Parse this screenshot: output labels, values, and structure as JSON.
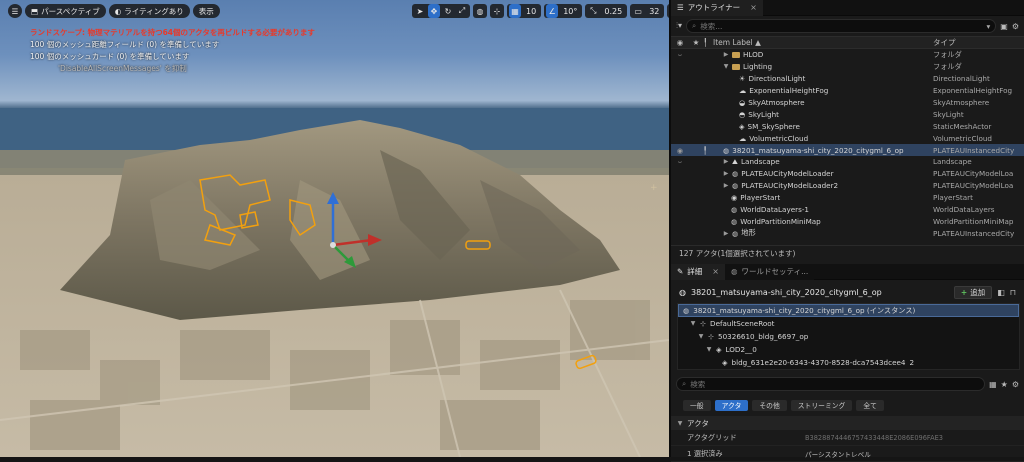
{
  "viewport": {
    "perspective_label": "パースペクティブ",
    "lighting_label": "ライティングあり",
    "show_label": "表示",
    "grid_snap_value": "10",
    "rotation_snap_value": "10°",
    "scale_snap_value": "0.25",
    "camera_speed_value": "32",
    "messages": {
      "warning": "ランドスケープ: 物理マテリアルを持つ64個のアクタを再ビルドする必要があります",
      "info1": "100 個のメッシュ距離フィールド (0) を準備しています",
      "info2": "100 個のメッシュカード (0) を準備しています",
      "suppress": "'DisableAllScreenMessages' を抑制"
    }
  },
  "outliner": {
    "tab_label": "アウトライナー",
    "search_placeholder": "検索...",
    "col_label": "Item Label ▲",
    "col_type": "タイプ",
    "rows": [
      {
        "name": "HLOD",
        "type": "フォルダ"
      },
      {
        "name": "Lighting",
        "type": "フォルダ"
      },
      {
        "name": "DirectionalLight",
        "type": "DirectionalLight"
      },
      {
        "name": "ExponentialHeightFog",
        "type": "ExponentialHeightFog"
      },
      {
        "name": "SkyAtmosphere",
        "type": "SkyAtmosphere"
      },
      {
        "name": "SkyLight",
        "type": "SkyLight"
      },
      {
        "name": "SM_SkySphere",
        "type": "StaticMeshActor"
      },
      {
        "name": "VolumetricCloud",
        "type": "VolumetricCloud"
      },
      {
        "name": "38201_matsuyama-shi_city_2020_citygml_6_op",
        "type": "PLATEAUInstancedCity"
      },
      {
        "name": "Landscape",
        "type": "Landscape"
      },
      {
        "name": "PLATEAUCityModelLoader",
        "type": "PLATEAUCityModelLoa"
      },
      {
        "name": "PLATEAUCityModelLoader2",
        "type": "PLATEAUCityModelLoa"
      },
      {
        "name": "PlayerStart",
        "type": "PlayerStart"
      },
      {
        "name": "WorldDataLayers-1",
        "type": "WorldDataLayers"
      },
      {
        "name": "WorldPartitionMiniMap",
        "type": "WorldPartitionMiniMap"
      },
      {
        "name": "地形",
        "type": "PLATEAUInstancedCity"
      }
    ],
    "status": "127 アクタ(1個選択されています)"
  },
  "details": {
    "tab_label": "詳細",
    "tab2_label": "ワールドセッティ...",
    "actor_name": "38201_matsuyama-shi_city_2020_citygml_6_op",
    "add_label": "追加",
    "tree": [
      {
        "label": "38201_matsuyama-shi_city_2020_citygml_6_op (インスタンス)"
      },
      {
        "label": "DefaultSceneRoot"
      },
      {
        "label": "50326610_bldg_6697_op"
      },
      {
        "label": "LOD2__0"
      },
      {
        "label": "bldg_631e2e20-6343-4370-8528-dca7543dcee4",
        "suffix": "2"
      }
    ],
    "search_placeholder": "検索",
    "filters": [
      "一般",
      "アクタ",
      "その他",
      "ストリーミング",
      "全て"
    ],
    "section": "アクタ",
    "props": [
      {
        "k": "アクタグリッド",
        "v": "B3828874446757433448E2086E096FAE3"
      },
      {
        "k": "1 選択済み",
        "v": "パーシスタントレベル"
      }
    ]
  }
}
